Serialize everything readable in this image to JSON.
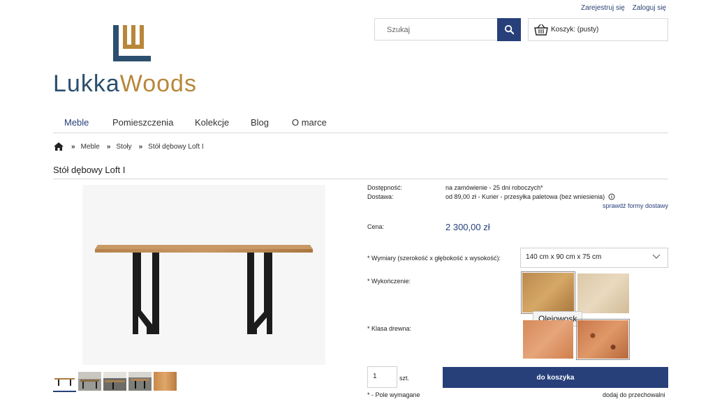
{
  "header": {
    "register_label": "Zarejestruj się",
    "login_label": "Zaloguj się",
    "search_placeholder": "Szukaj",
    "cart_label": "Koszyk: (pusty)",
    "brand_part1": "Lukka",
    "brand_part2": "Woods"
  },
  "colors": {
    "accent": "#27407a",
    "brand_dark": "#2b4f6e",
    "brand_gold": "#b8873a"
  },
  "nav": {
    "items": [
      {
        "label": "Meble"
      },
      {
        "label": "Pomieszczenia"
      },
      {
        "label": "Kolekcje"
      },
      {
        "label": "Blog"
      },
      {
        "label": "O marce"
      }
    ]
  },
  "breadcrumb": {
    "separator": "»",
    "items": [
      "Meble",
      "Stoły",
      "Stół dębowy Loft I"
    ]
  },
  "product": {
    "title": "Stół dębowy Loft I",
    "availability_label": "Dostępność:",
    "availability_value": "na zamówienie - 25 dni roboczych*",
    "delivery_label": "Dostawa:",
    "delivery_value": "od 89,00 zł - Kurier - przesyłka paletowa (bez wniesienia)",
    "delivery_link": "sprawdź formy dostawy",
    "price_label": "Cena:",
    "price_value": "2 300,00 zł",
    "dimensions_label": "* Wymiary (szerokość x głębokość x wysokość):",
    "dimensions_value": "140 cm x 90 cm x 75 cm",
    "finish_label": "* Wykończenie:",
    "wood_class_label": "* Klasa drewna:",
    "tooltip": "Olejowosk",
    "quantity_value": "1",
    "quantity_unit": "szt.",
    "add_to_cart": "do koszyka",
    "required_note": "* - Pole wymagane",
    "add_to_stash": "dodaj do przechowalni"
  }
}
